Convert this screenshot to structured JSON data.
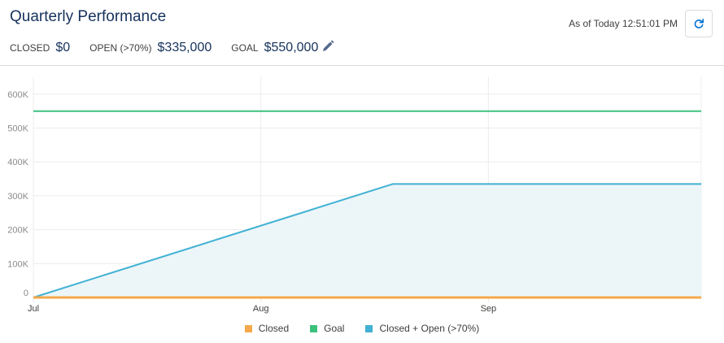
{
  "header": {
    "title": "Quarterly Performance",
    "as_of": "As of Today 12:51:01 PM",
    "refresh_icon": "refresh-icon",
    "edit_icon": "pencil-icon"
  },
  "metrics": {
    "closed_label": "CLOSED",
    "closed_value": "$0",
    "open_label": "OPEN (>70%)",
    "open_value": "$335,000",
    "goal_label": "GOAL",
    "goal_value": "$550,000"
  },
  "colors": {
    "closed": "#f5a94a",
    "goal": "#3cc17d",
    "closed_open": "#41b1d4",
    "closed_open_fill": "#ecf6f9",
    "grid": "#ececec"
  },
  "chart_data": {
    "type": "line",
    "x_tick_labels": [
      "Jul",
      "Aug",
      "Sep"
    ],
    "y_tick_labels": [
      "0",
      "100K",
      "200K",
      "300K",
      "400K",
      "500K",
      "600K"
    ],
    "ylim": [
      0,
      650000
    ],
    "legend_position": "bottom",
    "grid": true,
    "series": [
      {
        "name": "Closed",
        "color_key": "closed",
        "area": false,
        "points": [
          {
            "x": "Jul 1",
            "y": 0
          },
          {
            "x": "Sep 30",
            "y": 0
          }
        ]
      },
      {
        "name": "Goal",
        "color_key": "goal",
        "area": false,
        "points": [
          {
            "x": "Jul 1",
            "y": 550000
          },
          {
            "x": "Sep 30",
            "y": 550000
          }
        ]
      },
      {
        "name": "Closed + Open (>70%)",
        "color_key": "closed_open",
        "area": true,
        "points": [
          {
            "x": "Jul 1",
            "y": 0
          },
          {
            "x": "Aug 19",
            "y": 335000
          },
          {
            "x": "Sep 30",
            "y": 335000
          }
        ]
      }
    ]
  }
}
